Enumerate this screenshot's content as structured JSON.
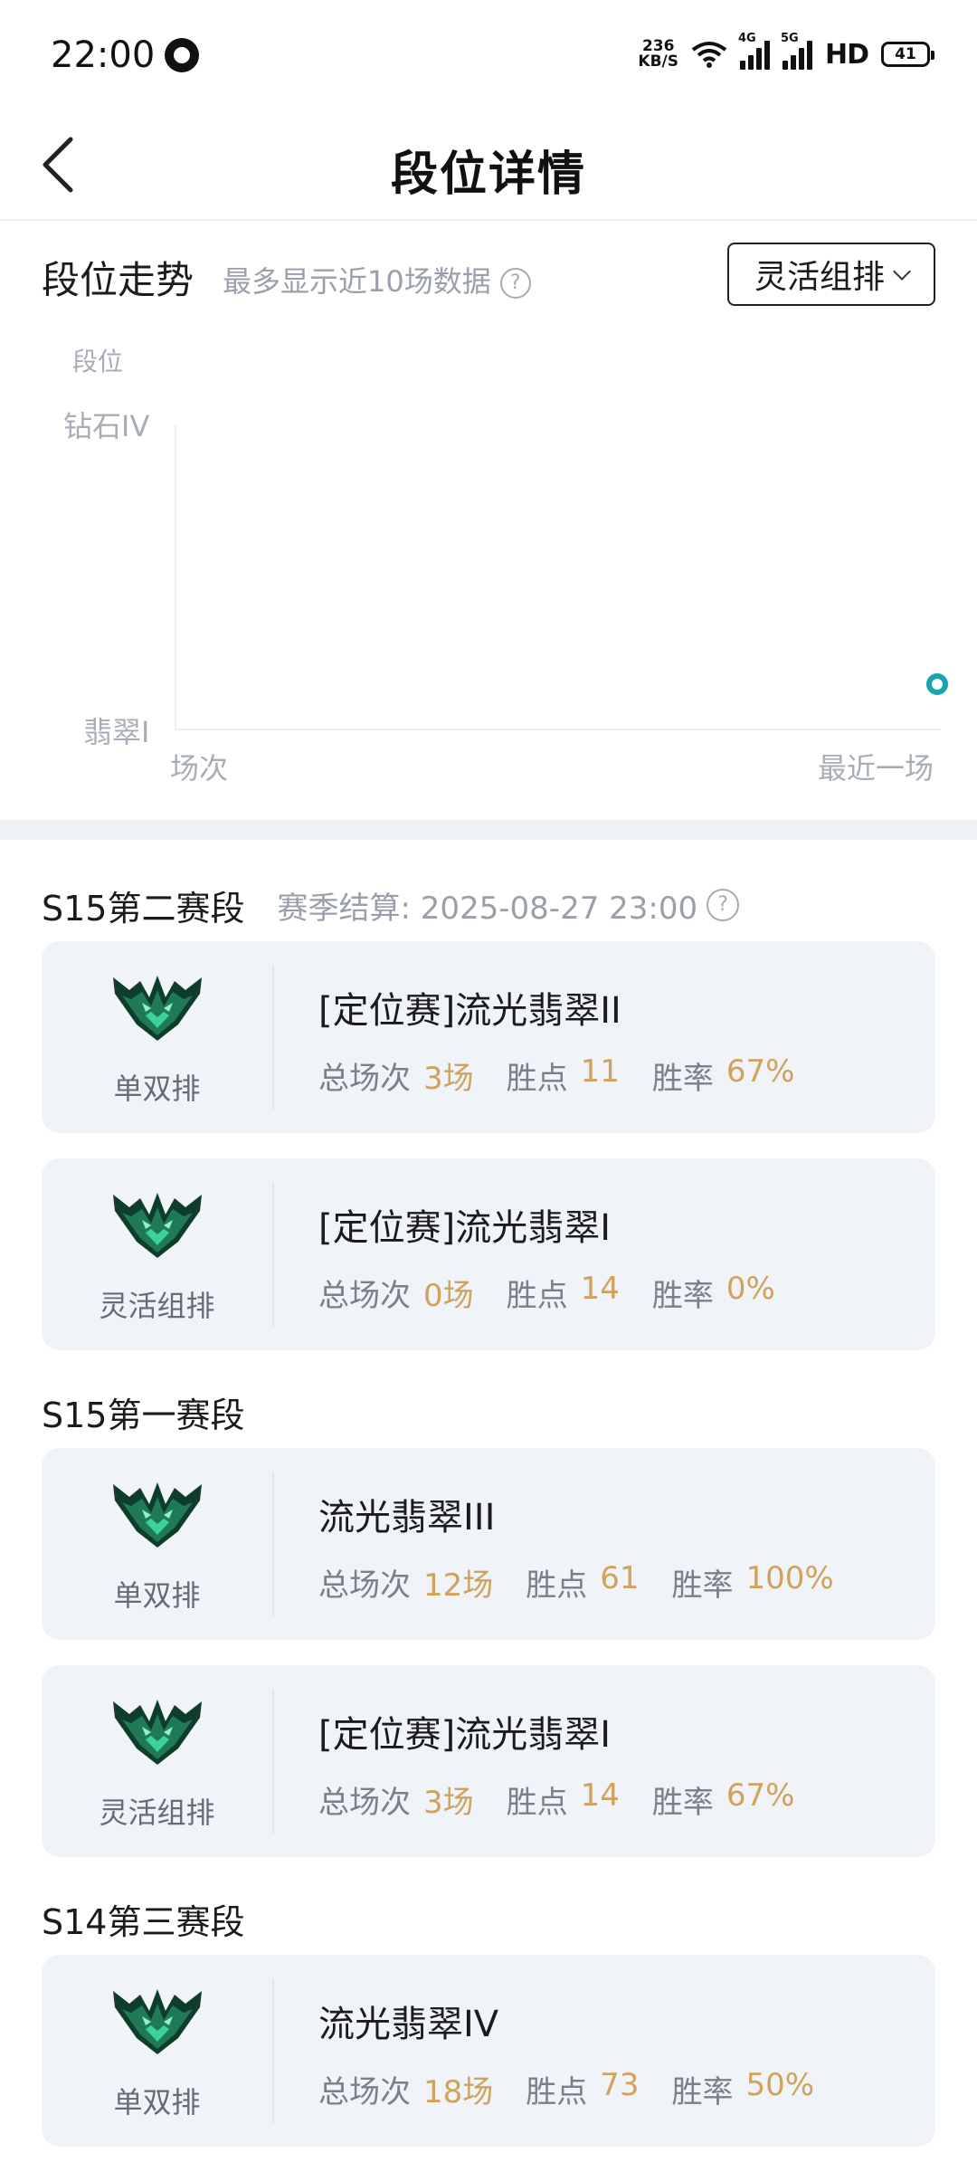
{
  "status_bar": {
    "time": "22:00",
    "speed_value": "236",
    "speed_unit": "KB/S",
    "sig1_label": "4G",
    "sig2_label": "5G",
    "hd": "HD",
    "battery": "41",
    "icons": [
      "app-notification-icon",
      "wifi-icon",
      "signal-4g-icon",
      "signal-5g-icon",
      "hd-icon",
      "battery-icon"
    ]
  },
  "nav": {
    "title": "段位详情",
    "back_icon": "chevron-left-icon"
  },
  "trend": {
    "title": "段位走势",
    "subtitle": "最多显示近10场数据",
    "help": "?",
    "mode_selected": "灵活组排",
    "y_axis_title": "段位",
    "y_top": "钻石IV",
    "y_bottom": "翡翠I",
    "x_left": "场次",
    "x_right": "最近一场",
    "accent": "#1aa3b0"
  },
  "chart_data": {
    "type": "line",
    "ylabel": "段位",
    "yticks": [
      "翡翠I",
      "钻石IV"
    ],
    "xticks": [
      "场次",
      "最近一场"
    ],
    "series": [
      {
        "x": [
          "最近一场"
        ],
        "values": [
          "翡翠I"
        ]
      }
    ]
  },
  "seasons": [
    {
      "name": "S15第二赛段",
      "settle": "赛季结算: 2025-08-27 23:00",
      "help": "?",
      "cards": [
        {
          "queue": "单双排",
          "rank": "[定位赛]流光翡翠II",
          "games_label": "总场次",
          "games": "3场",
          "lp_label": "胜点",
          "lp": "11",
          "wr_label": "胜率",
          "wr": "67%"
        },
        {
          "queue": "灵活组排",
          "rank": "[定位赛]流光翡翠I",
          "games_label": "总场次",
          "games": "0场",
          "lp_label": "胜点",
          "lp": "14",
          "wr_label": "胜率",
          "wr": "0%"
        }
      ]
    },
    {
      "name": "S15第一赛段",
      "settle": "",
      "cards": [
        {
          "queue": "单双排",
          "rank": "流光翡翠III",
          "games_label": "总场次",
          "games": "12场",
          "lp_label": "胜点",
          "lp": "61",
          "wr_label": "胜率",
          "wr": "100%"
        },
        {
          "queue": "灵活组排",
          "rank": "[定位赛]流光翡翠I",
          "games_label": "总场次",
          "games": "3场",
          "lp_label": "胜点",
          "lp": "14",
          "wr_label": "胜率",
          "wr": "67%"
        }
      ]
    },
    {
      "name": "S14第三赛段",
      "settle": "",
      "cards": [
        {
          "queue": "单双排",
          "rank": "流光翡翠IV",
          "games_label": "总场次",
          "games": "18场",
          "lp_label": "胜点",
          "lp": "73",
          "wr_label": "胜率",
          "wr": "50%"
        }
      ]
    }
  ],
  "colors": {
    "stat_value": "#d0a35c",
    "card_bg": "#f0f3f8",
    "muted": "#9aa0aa"
  }
}
